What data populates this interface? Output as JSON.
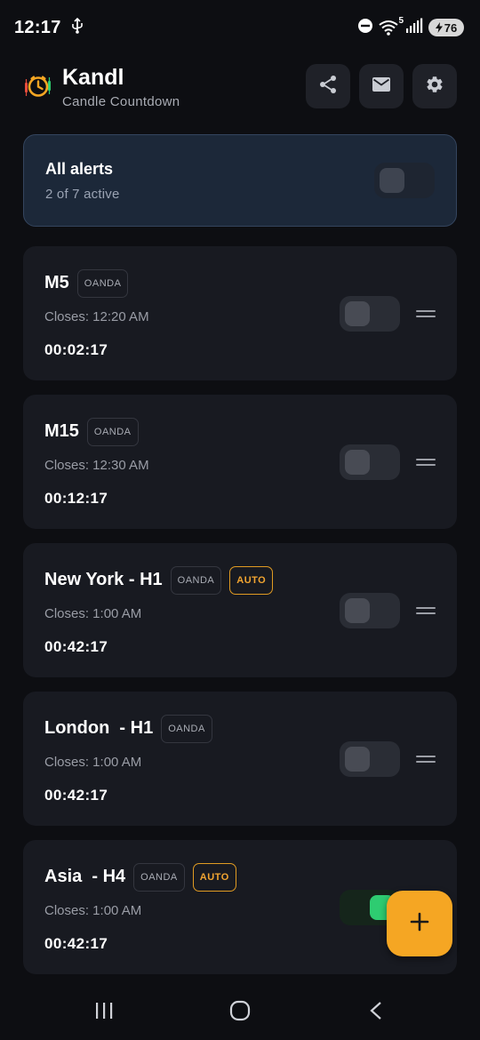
{
  "status_bar": {
    "time": "12:17",
    "battery_level": "76",
    "icons": [
      "usb-icon",
      "dnd-icon",
      "wifi-icon",
      "signal-icon",
      "battery-icon"
    ],
    "wifi_badge": "5"
  },
  "header": {
    "app_name": "Kandl",
    "subtitle": "Candle Countdown",
    "actions": [
      "share-icon",
      "mail-icon",
      "settings-icon"
    ]
  },
  "all_alerts": {
    "title": "All alerts",
    "summary": "2 of 7 active",
    "enabled": false
  },
  "alerts": [
    {
      "name": "M5",
      "badges": [
        "OANDA"
      ],
      "auto": false,
      "closes": "Closes: 12:20 AM",
      "countdown": "00:02:17",
      "enabled": false
    },
    {
      "name": "M15",
      "badges": [
        "OANDA"
      ],
      "auto": false,
      "closes": "Closes: 12:30 AM",
      "countdown": "00:12:17",
      "enabled": false
    },
    {
      "name": "New York - H1",
      "badges": [
        "OANDA"
      ],
      "auto": true,
      "auto_label": "AUTO",
      "closes": "Closes: 1:00 AM",
      "countdown": "00:42:17",
      "enabled": false
    },
    {
      "name": "London  - H1",
      "badges": [
        "OANDA"
      ],
      "auto": false,
      "closes": "Closes: 1:00 AM",
      "countdown": "00:42:17",
      "enabled": false
    },
    {
      "name": "Asia  - H4",
      "badges": [
        "OANDA"
      ],
      "auto": true,
      "auto_label": "AUTO",
      "closes": "Closes: 1:00 AM",
      "countdown": "00:42:17",
      "enabled": true
    }
  ],
  "fab": {
    "icon": "plus-icon"
  },
  "nav_bar": {
    "buttons": [
      "recent-apps-icon",
      "home-icon",
      "back-icon"
    ]
  },
  "colors": {
    "background": "#0d0e12",
    "card": "#181a21",
    "accent": "#f5a623",
    "toggle_on": "#2ecc71",
    "all_alerts_card": "#1c2839"
  }
}
